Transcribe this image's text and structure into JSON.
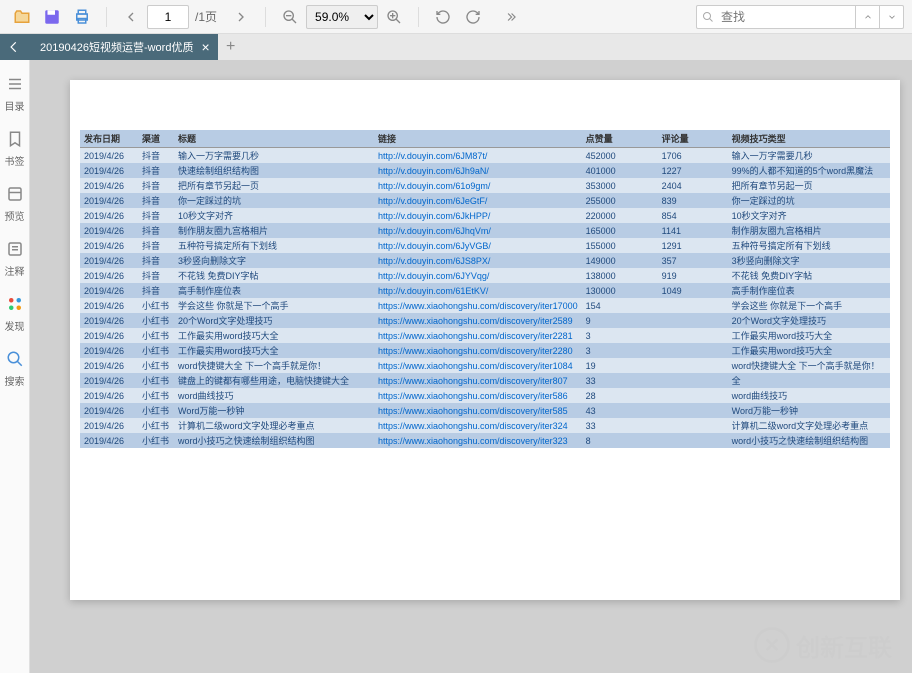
{
  "toolbar": {
    "page_current": "1",
    "page_total": "/1页",
    "zoom": "59.0%",
    "search_placeholder": "查找"
  },
  "tabs": {
    "active": "20190426短视频运营-word优质"
  },
  "sidebar": {
    "items": [
      {
        "label": "目录"
      },
      {
        "label": "书签"
      },
      {
        "label": "预览"
      },
      {
        "label": "注释"
      },
      {
        "label": "发现"
      },
      {
        "label": "搜索"
      }
    ]
  },
  "table": {
    "headers": [
      "发布日期",
      "渠道",
      "标题",
      "链接",
      "点赞量",
      "评论量",
      "视频技巧类型"
    ],
    "rows": [
      [
        "2019/4/26",
        "抖音",
        "输入一万字需要几秒",
        "http://v.douyin.com/6JM87t/",
        "452000",
        "1706",
        "输入一万字需要几秒"
      ],
      [
        "2019/4/26",
        "抖音",
        "快速绘制组织结构图",
        "http://v.douyin.com/6Jh9aN/",
        "401000",
        "1227",
        "99%的人都不知道的5个word黑魔法"
      ],
      [
        "2019/4/26",
        "抖音",
        "把所有章节另起一页",
        "http://v.douyin.com/61o9gm/",
        "353000",
        "2404",
        "把所有章节另起一页"
      ],
      [
        "2019/4/26",
        "抖音",
        "你一定踩过的坑",
        "http://v.douyin.com/6JeGtF/",
        "255000",
        "839",
        "你一定踩过的坑"
      ],
      [
        "2019/4/26",
        "抖音",
        "10秒文字对齐",
        "http://v.douyin.com/6JkHPP/",
        "220000",
        "854",
        "10秒文字对齐"
      ],
      [
        "2019/4/26",
        "抖音",
        "制作朋友圈九宫格相片",
        "http://v.douyin.com/6JhqVm/",
        "165000",
        "1141",
        "制作朋友圈九宫格相片"
      ],
      [
        "2019/4/26",
        "抖音",
        "五种符号搞定所有下划线",
        "http://v.douyin.com/6JyVGB/",
        "155000",
        "1291",
        "五种符号搞定所有下划线"
      ],
      [
        "2019/4/26",
        "抖音",
        "3秒竖向删除文字",
        "http://v.douyin.com/6JS8PX/",
        "149000",
        "357",
        "3秒竖向删除文字"
      ],
      [
        "2019/4/26",
        "抖音",
        "不花钱 免费DIY字帖",
        "http://v.douyin.com/6JYVqg/",
        "138000",
        "919",
        "不花钱 免费DIY字帖"
      ],
      [
        "2019/4/26",
        "抖音",
        "高手制作座位表",
        "http://v.douyin.com/61EtKV/",
        "130000",
        "1049",
        "高手制作座位表"
      ],
      [
        "2019/4/26",
        "小红书",
        "学会这些 你就是下一个高手",
        "https://www.xiaohongshu.com/discovery/iter17000",
        "154",
        "",
        "学会这些 你就是下一个高手"
      ],
      [
        "2019/4/26",
        "小红书",
        "20个Word文字处理技巧",
        "https://www.xiaohongshu.com/discovery/iter2589",
        "9",
        "",
        "20个Word文字处理技巧"
      ],
      [
        "2019/4/26",
        "小红书",
        "工作最实用word技巧大全",
        "https://www.xiaohongshu.com/discovery/iter2281",
        "3",
        "",
        "工作最实用word技巧大全"
      ],
      [
        "2019/4/26",
        "小红书",
        "工作最实用word技巧大全",
        "https://www.xiaohongshu.com/discovery/iter2280",
        "3",
        "",
        "工作最实用word技巧大全"
      ],
      [
        "2019/4/26",
        "小红书",
        "word快捷键大全 下一个高手就是你！",
        "https://www.xiaohongshu.com/discovery/iter1084",
        "19",
        "",
        "word快捷键大全 下一个高手就是你！"
      ],
      [
        "2019/4/26",
        "小红书",
        "键盘上的键都有哪些用途，电脑快捷键大全",
        "https://www.xiaohongshu.com/discovery/iter807",
        "33",
        "",
        "全"
      ],
      [
        "2019/4/26",
        "小红书",
        "word曲线技巧",
        "https://www.xiaohongshu.com/discovery/iter586",
        "28",
        "",
        "word曲线技巧"
      ],
      [
        "2019/4/26",
        "小红书",
        "Word万能一秒钟",
        "https://www.xiaohongshu.com/discovery/iter585",
        "43",
        "",
        "Word万能一秒钟"
      ],
      [
        "2019/4/26",
        "小红书",
        "计算机二级word文字处理必考重点",
        "https://www.xiaohongshu.com/discovery/iter324",
        "33",
        "",
        "计算机二级word文字处理必考重点"
      ],
      [
        "2019/4/26",
        "小红书",
        "word小技巧之快速绘制组织结构图",
        "https://www.xiaohongshu.com/discovery/iter323",
        "8",
        "",
        "word小技巧之快速绘制组织结构图"
      ]
    ]
  },
  "watermark": "创新互联"
}
